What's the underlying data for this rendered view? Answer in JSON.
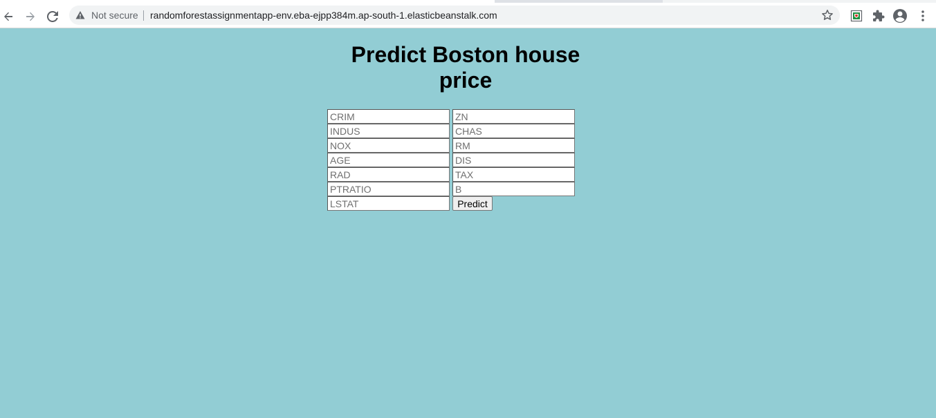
{
  "browser": {
    "security_label": "Not secure",
    "url": "randomforestassignmentapp-env.eba-ejpp384m.ap-south-1.elasticbeanstalk.com",
    "icons": [
      "back-icon",
      "forward-icon",
      "reload-icon",
      "warning-icon",
      "star-icon",
      "extension-shield-icon",
      "puzzle-icon",
      "profile-icon",
      "menu-icon"
    ]
  },
  "page": {
    "title": "Predict Boston house price",
    "background_color": "#92cdd4",
    "fields": [
      {
        "placeholder": "CRIM",
        "value": ""
      },
      {
        "placeholder": "ZN",
        "value": ""
      },
      {
        "placeholder": "INDUS",
        "value": ""
      },
      {
        "placeholder": "CHAS",
        "value": ""
      },
      {
        "placeholder": "NOX",
        "value": ""
      },
      {
        "placeholder": "RM",
        "value": ""
      },
      {
        "placeholder": "AGE",
        "value": ""
      },
      {
        "placeholder": "DIS",
        "value": ""
      },
      {
        "placeholder": "RAD",
        "value": ""
      },
      {
        "placeholder": "TAX",
        "value": ""
      },
      {
        "placeholder": "PTRATIO",
        "value": ""
      },
      {
        "placeholder": "B",
        "value": ""
      },
      {
        "placeholder": "LSTAT",
        "value": ""
      }
    ],
    "submit_label": "Predict"
  }
}
